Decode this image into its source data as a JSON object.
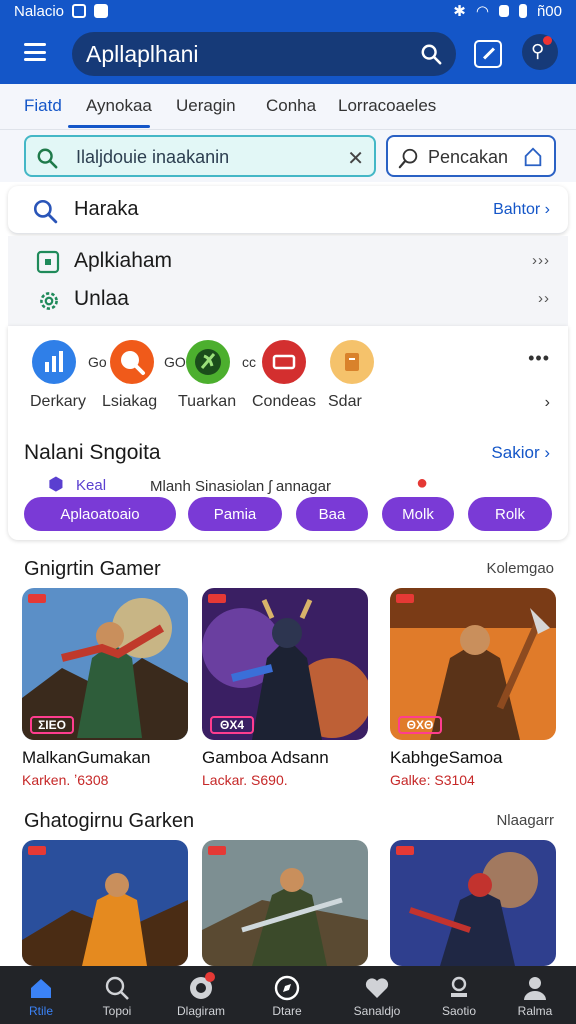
{
  "status_bar": {
    "left_text": "Nalacio",
    "right_text": "ñ00"
  },
  "header": {
    "title": "Apllaplhani"
  },
  "tabs": [
    {
      "label": "Fiatd"
    },
    {
      "label": "Aynokaa"
    },
    {
      "label": "Ueragin"
    },
    {
      "label": "Conha"
    },
    {
      "label": "Lorracoaeles"
    }
  ],
  "search": {
    "placeholder": "Ilaljdouie inaakanin",
    "secondary": "Pencakan"
  },
  "quick_row": {
    "label": "Haraka",
    "more": "Bahtor ›"
  },
  "menu": [
    {
      "label": "Aplkiaham",
      "arrow": "›››"
    },
    {
      "label": "Unlaa",
      "arrow": "››"
    }
  ],
  "apps": [
    {
      "pre": "",
      "label": "Derkary",
      "color": "#2f7fe8"
    },
    {
      "pre": "Go",
      "label": "Lsiakag",
      "color": "#f05a1a"
    },
    {
      "pre": "GO",
      "label": "Tuarkan",
      "color": "#4caf2e"
    },
    {
      "pre": "cc",
      "label": "Condeas",
      "color": "#d32f2f"
    },
    {
      "pre": "",
      "label": "Sdar",
      "color": "#f5c26b"
    }
  ],
  "section": {
    "title": "Nalani Sngoita",
    "more": "Sakior ›",
    "promo_left": "Keal",
    "promo_text": "Mlanh Sinasiolan ʃ annagar"
  },
  "chips": [
    {
      "label": "Aplaoatoaio"
    },
    {
      "label": "Pamia"
    },
    {
      "label": "Baa"
    },
    {
      "label": "Molk"
    },
    {
      "label": "Rolk"
    }
  ],
  "games_section_1": {
    "title": "Gnigrtin Gamer",
    "more": "Kolemgao",
    "items": [
      {
        "name": "MalkanGumakan",
        "meta": "Karken. ʼ6308",
        "logo": "ΣΙΕΟ",
        "sky": "#5b8fc7",
        "accent": "#c0392b"
      },
      {
        "name": "Gamboa Adsann",
        "meta": "Lackar. S690.",
        "logo": "ΘΧ4",
        "sky": "#6a3fa0",
        "accent": "#3a6fd8"
      },
      {
        "name": "KabhgeSamoa",
        "meta": "Galke: S3104",
        "logo": "ΘΧΘ",
        "sky": "#e07b2a",
        "accent": "#8d4a1f"
      }
    ]
  },
  "games_section_2": {
    "title": "Ghatogirnu Garken",
    "more": "Nlaagarr",
    "items": [
      {
        "name": "",
        "meta": "",
        "logo": "",
        "sky": "#2a4f9c",
        "accent": "#e58a1f"
      },
      {
        "name": "",
        "meta": "",
        "logo": "",
        "sky": "#7d8f92",
        "accent": "#5a4a32"
      },
      {
        "name": "",
        "meta": "",
        "logo": "",
        "sky": "#2f3f8e",
        "accent": "#c2332e"
      }
    ]
  },
  "bottom_nav": [
    {
      "label": "Rtile",
      "active": true
    },
    {
      "label": "Topoi",
      "active": false
    },
    {
      "label": "Dlagiram",
      "active": false,
      "badge": true
    },
    {
      "label": "Dtare",
      "active": false
    },
    {
      "label": "Sanaldjo",
      "active": false
    },
    {
      "label": "Saotio",
      "active": false
    },
    {
      "label": "Ralma",
      "active": false
    }
  ]
}
